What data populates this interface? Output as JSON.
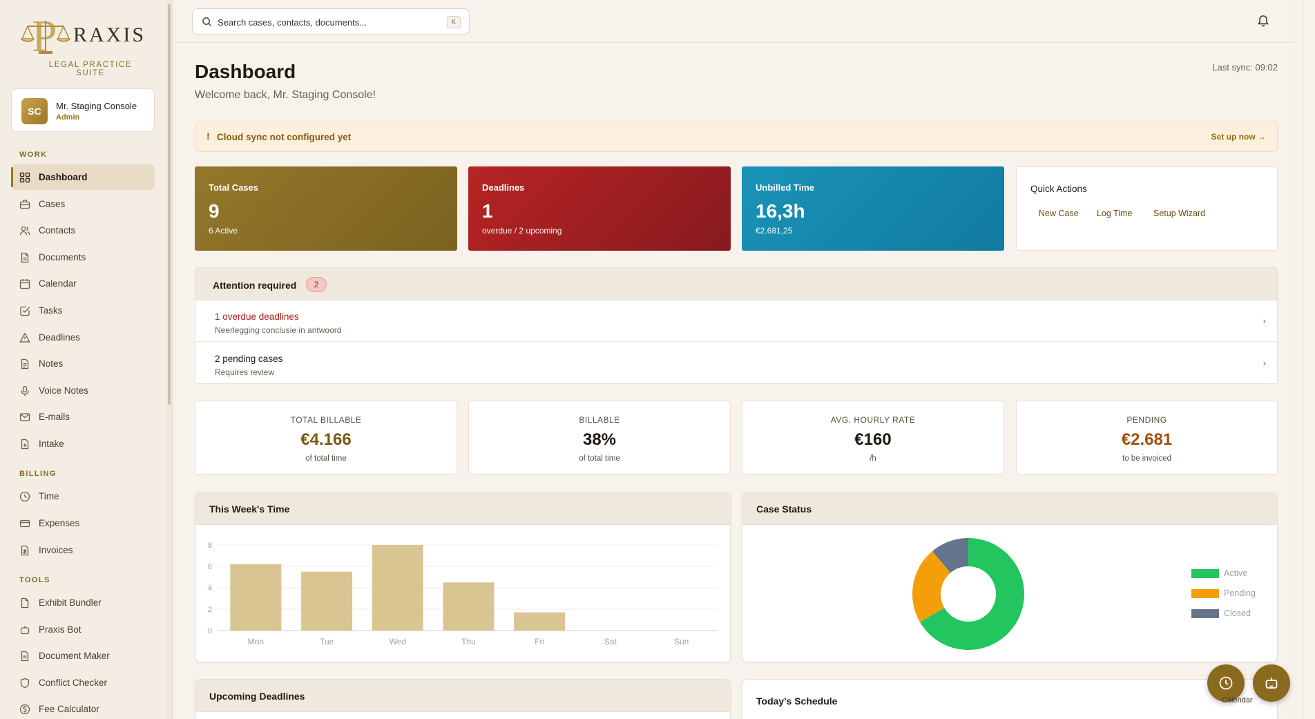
{
  "app": {
    "logo_word": "RAXIS",
    "logo_letter": "P",
    "logo_sub": "LEGAL PRACTICE SUITE"
  },
  "user": {
    "initials": "SC",
    "name": "Mr. Staging Console",
    "role": "Admin"
  },
  "sidebar": {
    "sections": [
      {
        "title": "WORK",
        "items": [
          {
            "label": "Dashboard",
            "icon": "grid-icon",
            "active": true
          },
          {
            "label": "Cases",
            "icon": "briefcase-icon"
          },
          {
            "label": "Contacts",
            "icon": "users-icon"
          },
          {
            "label": "Documents",
            "icon": "document-icon"
          },
          {
            "label": "Calendar",
            "icon": "calendar-icon"
          },
          {
            "label": "Tasks",
            "icon": "checkbox-icon"
          },
          {
            "label": "Deadlines",
            "icon": "warning-icon"
          },
          {
            "label": "Notes",
            "icon": "note-icon"
          },
          {
            "label": "Voice Notes",
            "icon": "microphone-icon"
          },
          {
            "label": "E-mails",
            "icon": "mail-icon"
          },
          {
            "label": "Intake",
            "icon": "intake-icon"
          }
        ]
      },
      {
        "title": "BILLING",
        "items": [
          {
            "label": "Time",
            "icon": "clock-icon"
          },
          {
            "label": "Expenses",
            "icon": "card-icon"
          },
          {
            "label": "Invoices",
            "icon": "invoice-icon"
          }
        ]
      },
      {
        "title": "TOOLS",
        "items": [
          {
            "label": "Exhibit Bundler",
            "icon": "bundle-icon"
          },
          {
            "label": "Praxis Bot",
            "icon": "bot-icon"
          },
          {
            "label": "Document Maker",
            "icon": "doc-maker-icon"
          },
          {
            "label": "Conflict Checker",
            "icon": "shield-icon"
          },
          {
            "label": "Fee Calculator",
            "icon": "currency-icon"
          }
        ]
      }
    ]
  },
  "search": {
    "placeholder": "Search cases, contacts, documents...",
    "shortcut": "K"
  },
  "header": {
    "title": "Dashboard",
    "welcome": "Welcome back, Mr. Staging Console!",
    "last_sync": "Last sync: 09:02"
  },
  "banner": {
    "icon": "!",
    "message": "Cloud sync not configured yet",
    "action": "Set up now →"
  },
  "stats": [
    {
      "label": "Total Cases",
      "value": "9",
      "sub": "6 Active"
    },
    {
      "label": "Deadlines",
      "value": "1",
      "sub": "overdue / 2 upcoming"
    },
    {
      "label": "Unbilled Time",
      "value": "16,3h",
      "sub": "€2.681,25"
    }
  ],
  "quick_actions": {
    "title": "Quick Actions",
    "actions": [
      "New Case",
      "Log Time",
      "Setup Wizard"
    ]
  },
  "attention": {
    "title": "Attention required",
    "count": "2",
    "rows": [
      {
        "title": "1 overdue deadlines",
        "sub": "Neerlegging conclusie in antwoord",
        "chevron": "›"
      },
      {
        "title": "2 pending cases",
        "sub": "Requires review",
        "chevron": "›"
      }
    ]
  },
  "kpis": [
    {
      "label": "TOTAL BILLABLE",
      "value": "€4.166",
      "sub": "of total time",
      "color": "#7a5a12"
    },
    {
      "label": "BILLABLE",
      "value": "38%",
      "sub": "of total time",
      "color": "#1f1a12"
    },
    {
      "label": "AVG. HOURLY RATE",
      "value": "€160",
      "sub": "/h",
      "color": "#1f1a12"
    },
    {
      "label": "PENDING",
      "value": "€2.681",
      "sub": "to be invoiced",
      "color": "#a0520f"
    }
  ],
  "panels": {
    "week_time": "This Week's Time",
    "case_status": "Case Status",
    "upcoming": "Upcoming Deadlines",
    "schedule": "Today's Schedule",
    "calendar_label": "Calendar"
  },
  "chart_data": [
    {
      "type": "bar",
      "categories": [
        "Mon",
        "Tue",
        "Wed",
        "Thu",
        "Fri",
        "Sat",
        "Sun"
      ],
      "values": [
        6.2,
        5.5,
        8.0,
        4.5,
        1.7,
        0,
        0
      ],
      "ylim": [
        0,
        8
      ],
      "yticks": [
        0,
        2,
        4,
        6,
        8
      ],
      "grid": true,
      "color": "#d9c592"
    },
    {
      "type": "pie",
      "donut": true,
      "labels": [
        "Active",
        "Pending",
        "Closed"
      ],
      "values": [
        6,
        2,
        1
      ],
      "colors": [
        "#22c55e",
        "#f59e0b",
        "#64748b"
      ],
      "legend": "right"
    }
  ]
}
